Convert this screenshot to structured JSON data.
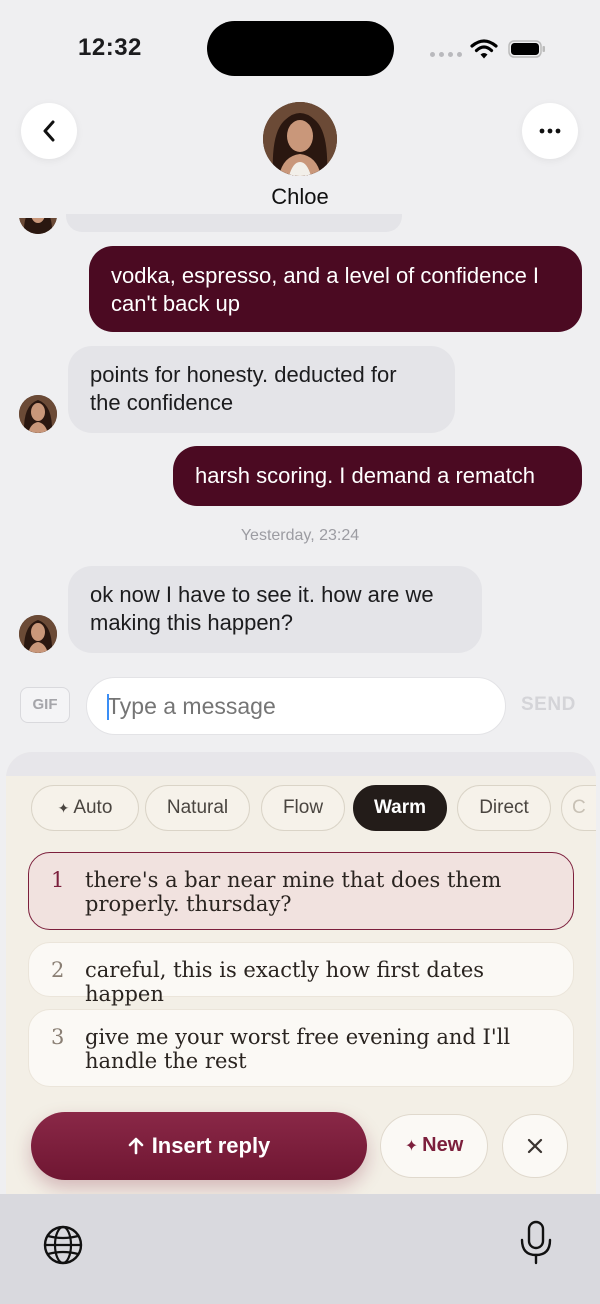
{
  "status_bar": {
    "time": "12:32"
  },
  "header": {
    "contact_name": "Chloe"
  },
  "messages": [
    {
      "direction": "out",
      "text": "vodka, espresso, and a level of confidence I can't back up"
    },
    {
      "direction": "in",
      "text": "points for honesty. deducted for the confidence"
    },
    {
      "direction": "out",
      "text": "harsh scoring. I demand a rematch"
    },
    {
      "direction": "in",
      "text": "ok now I have to see it. how are we making this happen?"
    }
  ],
  "timestamp": "Yesterday, 23:24",
  "composer": {
    "gif_label": "GIF",
    "placeholder": "Type a message",
    "send_label": "SEND"
  },
  "suggestions": {
    "tones": [
      "Auto",
      "Natural",
      "Flow",
      "Warm",
      "Direct",
      "C"
    ],
    "selected_tone": "Warm",
    "replies": [
      {
        "number": "1",
        "text": "there's a bar near mine that does them properly. thursday?",
        "selected": true
      },
      {
        "number": "2",
        "text": "careful, this is exactly how first dates happen",
        "selected": false
      },
      {
        "number": "3",
        "text": "give me your worst free evening and I'll handle the rest",
        "selected": false
      }
    ],
    "insert_label": "Insert reply",
    "new_label": "New"
  },
  "colors": {
    "outgoing_bubble": "#4b0a22",
    "incoming_bubble": "#e4e4e8",
    "accent": "#7c1f3c",
    "sheet_background": "#f3efe6"
  },
  "icons": [
    "back-icon",
    "more-icon",
    "sparkle-icon",
    "up-arrow-icon",
    "close-icon",
    "globe-icon",
    "microphone-icon"
  ]
}
